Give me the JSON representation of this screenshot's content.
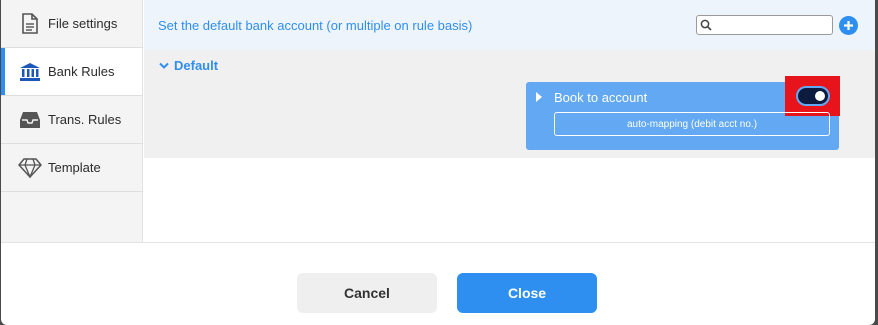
{
  "sidebar": {
    "items": [
      {
        "label": "File settings",
        "icon": "file-icon",
        "active": false
      },
      {
        "label": "Bank Rules",
        "icon": "bank-icon",
        "active": true
      },
      {
        "label": "Trans. Rules",
        "icon": "inbox-icon",
        "active": false
      },
      {
        "label": "Template",
        "icon": "diamond-icon",
        "active": false
      }
    ]
  },
  "header": {
    "description": "Set the default bank account (or multiple on rule basis)",
    "search_value": "",
    "search_placeholder": ""
  },
  "group": {
    "label": "Default"
  },
  "rule": {
    "title": "Book to account",
    "toggle_on": true,
    "mapping_label": "auto-mapping (debit acct no.)"
  },
  "footer": {
    "cancel_label": "Cancel",
    "close_label": "Close"
  },
  "colors": {
    "accent": "#2f8ff0",
    "card": "#62a8f2",
    "toggle": "#0d1b3e",
    "highlight": "#e8141c"
  }
}
